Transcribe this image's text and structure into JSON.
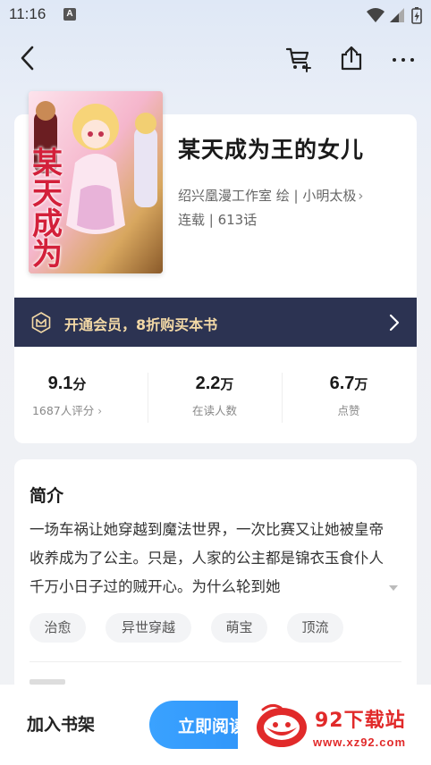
{
  "status_bar": {
    "time": "11:16",
    "notification_icon": "A"
  },
  "nav": {
    "back_icon": "chevron-left-icon",
    "cart_icon": "cart-icon",
    "share_icon": "share-icon",
    "more_icon": "more-icon"
  },
  "book": {
    "cover_title": "某天成为",
    "title": "某天成为王的女儿",
    "author": "绍兴凰漫工作室 绘 | 小明太极",
    "status": "连载 | 613话"
  },
  "vip": {
    "text": "开通会员，8折购买本书",
    "accent": "#f3d9a6",
    "background": "#2c3352"
  },
  "stats": [
    {
      "value": "9.1",
      "unit": "分",
      "label": "1687人评分"
    },
    {
      "value": "2.2",
      "unit": "万",
      "label": "在读人数"
    },
    {
      "value": "6.7",
      "unit": "万",
      "label": "点赞"
    }
  ],
  "synopsis": {
    "title": "简介",
    "text": "一场车祸让她穿越到魔法世界，一次比赛又让她被皇帝收养成为了公主。只是，人家的公主都是锦衣玉食仆人千万小日子过的贼开心。为什么轮到她"
  },
  "tags": [
    "治愈",
    "异世穿越",
    "萌宝",
    "顶流"
  ],
  "bottom": {
    "shelf_label": "加入书架",
    "read_label": "立即阅读",
    "read_color": "#2a8cf7"
  },
  "watermark": {
    "title": "92下载站",
    "url": "www.xz92.com"
  }
}
